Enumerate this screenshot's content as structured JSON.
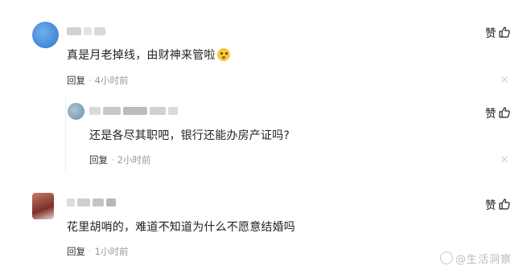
{
  "comments": [
    {
      "text": "真是月老掉线，由财神来管啦",
      "emoji": "thinking-face-emoji",
      "reply_label": "回复",
      "time": "4小时前",
      "like_label": "赞"
    },
    {
      "text": "还是各尽其职吧，银行还能办房产证吗?",
      "reply_label": "回复",
      "time": "2小时前",
      "like_label": "赞"
    },
    {
      "text": "花里胡哨的，难道不知道为什么不愿意结婚吗",
      "reply_label": "回复",
      "time": "1小时前",
      "like_label": "赞"
    }
  ],
  "watermark": "@生活洞察",
  "colors": {
    "meta": "#999999",
    "text": "#222222",
    "avatar1": "#3a86d8",
    "avatar2": "#7fa2b8",
    "avatar3": "#9b4a3e"
  }
}
